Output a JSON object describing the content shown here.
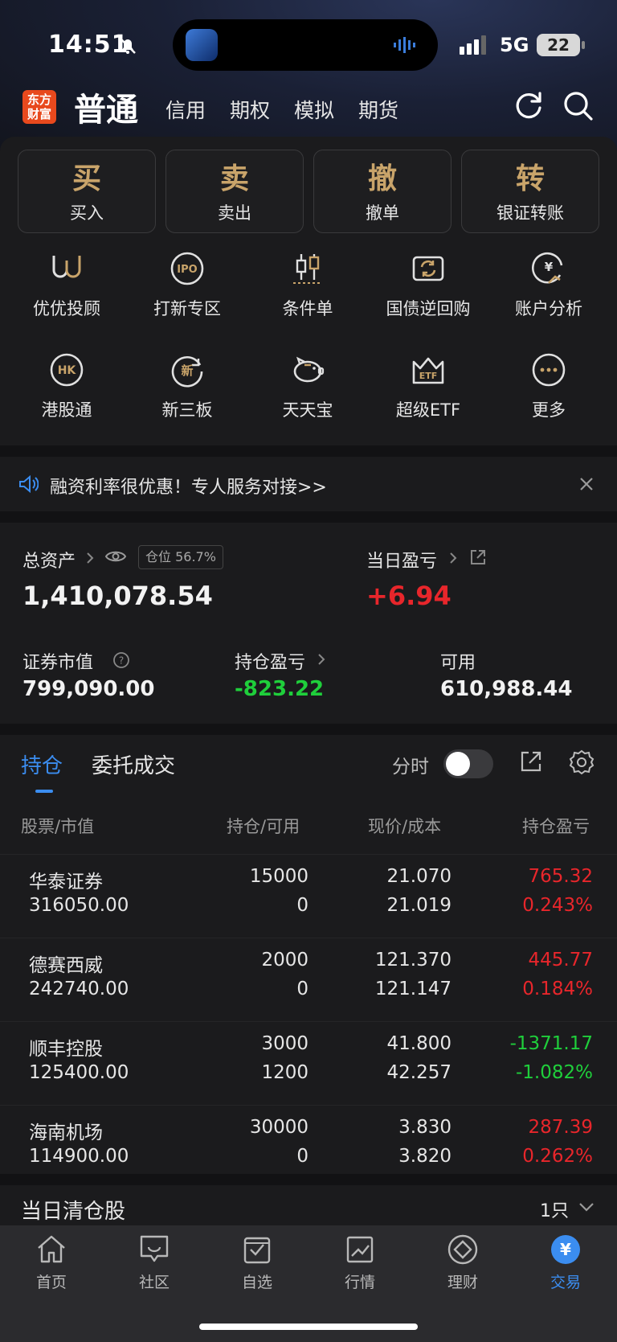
{
  "status_bar": {
    "time": "14:51",
    "network": "5G",
    "battery": "22"
  },
  "header": {
    "logo_line1": "东方",
    "logo_line2": "财富",
    "active_mode": "普通",
    "modes": [
      "信用",
      "期权",
      "模拟",
      "期货"
    ]
  },
  "actions": [
    {
      "glyph": "买",
      "label": "买入"
    },
    {
      "glyph": "卖",
      "label": "卖出"
    },
    {
      "glyph": "撤",
      "label": "撤单"
    },
    {
      "glyph": "转",
      "label": "银证转账"
    }
  ],
  "services": [
    {
      "label": "优优投顾",
      "icon": "uu-advisor-icon"
    },
    {
      "label": "打新专区",
      "icon": "ipo-icon"
    },
    {
      "label": "条件单",
      "icon": "candlestick-icon"
    },
    {
      "label": "国债逆回购",
      "icon": "repo-icon"
    },
    {
      "label": "账户分析",
      "icon": "yen-chart-icon"
    },
    {
      "label": "港股通",
      "icon": "hk-icon"
    },
    {
      "label": "新三板",
      "icon": "new-board-icon"
    },
    {
      "label": "天天宝",
      "icon": "piggy-bank-icon"
    },
    {
      "label": "超级ETF",
      "icon": "etf-crown-icon"
    },
    {
      "label": "更多",
      "icon": "more-icon"
    }
  ],
  "notice": {
    "text": "融资利率很优惠！专人服务对接>>"
  },
  "assets": {
    "total_label": "总资产",
    "position_badge": "仓位 56.7%",
    "total_value": "1,410,078.54",
    "daily_pl_label": "当日盈亏",
    "daily_pl_value": "+6.94",
    "market_value_label": "证券市值",
    "market_value": "799,090.00",
    "holding_pl_label": "持仓盈亏",
    "holding_pl_value": "-823.22",
    "available_label": "可用",
    "available_value": "610,988.44"
  },
  "holdings": {
    "tab_active": "持仓",
    "tab_other": "委托成交",
    "fenshi_label": "分时",
    "headers": [
      "股票/市值",
      "持仓/可用",
      "现价/成本",
      "持仓盈亏"
    ],
    "rows": [
      {
        "name": "华泰证券",
        "market_value": "316050.00",
        "position": "15000",
        "available": "0",
        "price": "21.070",
        "cost": "21.019",
        "pl": "765.32",
        "pl_pct": "0.243%",
        "sign": "up"
      },
      {
        "name": "德赛西威",
        "market_value": "242740.00",
        "position": "2000",
        "available": "0",
        "price": "121.370",
        "cost": "121.147",
        "pl": "445.77",
        "pl_pct": "0.184%",
        "sign": "up"
      },
      {
        "name": "顺丰控股",
        "market_value": "125400.00",
        "position": "3000",
        "available": "1200",
        "price": "41.800",
        "cost": "42.257",
        "pl": "-1371.17",
        "pl_pct": "-1.082%",
        "sign": "down"
      },
      {
        "name": "海南机场",
        "market_value": "114900.00",
        "position": "30000",
        "available": "0",
        "price": "3.830",
        "cost": "3.820",
        "pl": "287.39",
        "pl_pct": "0.262%",
        "sign": "up"
      }
    ]
  },
  "cleared": {
    "label": "当日清仓股",
    "count": "1只"
  },
  "tabbar": [
    {
      "label": "首页",
      "icon": "home-icon"
    },
    {
      "label": "社区",
      "icon": "community-icon"
    },
    {
      "label": "自选",
      "icon": "watchlist-icon"
    },
    {
      "label": "行情",
      "icon": "market-icon"
    },
    {
      "label": "理财",
      "icon": "finance-icon"
    },
    {
      "label": "交易",
      "icon": "trade-icon",
      "active": true
    }
  ],
  "colors": {
    "accent": "#3b8df0",
    "up": "#e8262b",
    "down": "#1fcf3b",
    "gold": "#c9a46a"
  }
}
